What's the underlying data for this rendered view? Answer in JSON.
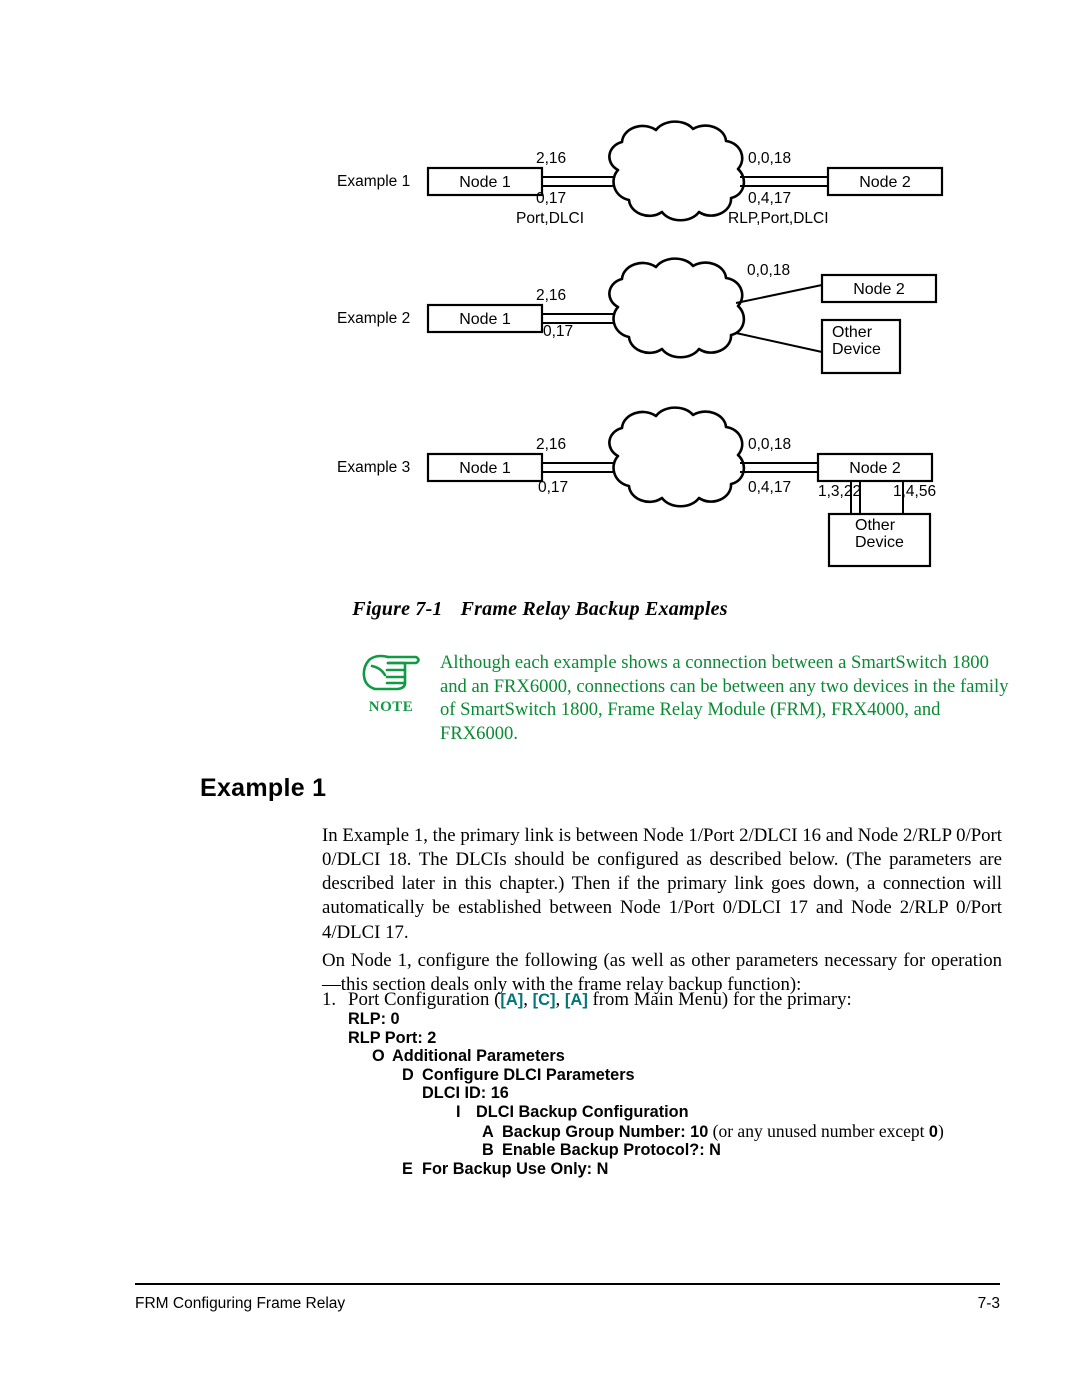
{
  "figure": {
    "caption_number": "Figure 7-1",
    "caption_title": "Frame Relay Backup Examples",
    "examples": [
      {
        "label": "Example 1",
        "left_node": "Node 1",
        "left_top_label": "2,16",
        "left_bottom_label": "0,17",
        "left_legend": "Port,DLCI",
        "right_top_label": "0,0,18",
        "right_bottom_label": "0,4,17",
        "right_legend": "RLP,Port,DLCI",
        "right_node": "Node 2"
      },
      {
        "label": "Example 2",
        "left_node": "Node 1",
        "left_top_label": "2,16",
        "left_bottom_label": "0,17",
        "right_top_label": "0,0,18",
        "right_node": "Node 2",
        "other_device_line1": "Other",
        "other_device_line2": "Device"
      },
      {
        "label": "Example 3",
        "left_node": "Node 1",
        "left_top_label": "2,16",
        "left_bottom_label": "0,17",
        "right_top_label": "0,0,18",
        "right_bottom_label": "0,4,17",
        "right_node": "Node 2",
        "down_left_label": "1,3,22",
        "down_right_label": "1,4,56",
        "other_device_line1": "Other",
        "other_device_line2": "Device"
      }
    ]
  },
  "note": {
    "icon_label": "NOTE",
    "text": "Although each example shows a connection between a SmartSwitch 1800 and an FRX6000, connections can be between any two devices in the family of SmartSwitch 1800, Frame Relay Module (FRM), FRX4000, and FRX6000.",
    "color": "#0a8a33"
  },
  "section": {
    "heading": "Example 1",
    "paragraph_1": "In Example 1, the primary link is between Node 1/Port 2/DLCI 16 and Node 2/RLP 0/Port 0/DLCI 18. The DLCIs should be configured as described below. (The parameters are described later in this chapter.) Then if the primary link goes down, a connection will automatically be established between Node 1/Port 0/DLCI 17 and Node 2/RLP 0/Port 4/DLCI 17.",
    "paragraph_2": "On Node 1, configure the following (as well as other parameters necessary for operation—this section deals only with the frame relay backup function):"
  },
  "step": {
    "number": "1.",
    "text_before": "Port Configuration (",
    "keys": [
      "[A]",
      "[C]",
      "[A]"
    ],
    "key_separator": ", ",
    "text_after": " from Main Menu) for the primary:",
    "key_color": "#00757a"
  },
  "config_tree": [
    {
      "key": "",
      "label": "RLP:  0",
      "indent": 0
    },
    {
      "key": "",
      "label": "RLP Port:  2",
      "indent": 0
    },
    {
      "key": "O",
      "label": "Additional Parameters",
      "indent": 1
    },
    {
      "key": "D",
      "label": "Configure DLCI Parameters",
      "indent": 2
    },
    {
      "key": "",
      "label": "DLCI ID:  16",
      "indent": 3
    },
    {
      "key": "I",
      "label": "DLCI Backup Configuration",
      "indent": 4
    },
    {
      "key": "A",
      "label": "Backup Group Number:  10",
      "indent": 5,
      "note_prefix": " (or any unused number except ",
      "note_bold": "0",
      "note_suffix": ")"
    },
    {
      "key": "B",
      "label": "Enable Backup Protocol?:  N",
      "indent": 5
    },
    {
      "key": "E",
      "label": "For Backup Use Only:  N",
      "indent": 2
    }
  ],
  "footer": {
    "left": "FRM Configuring Frame Relay",
    "right": "7-3"
  }
}
